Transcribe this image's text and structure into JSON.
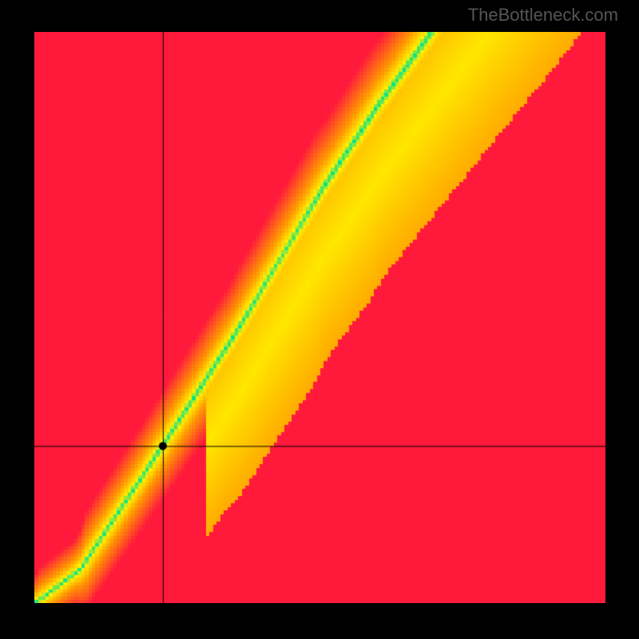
{
  "watermark": "TheBottleneck.com",
  "chart_data": {
    "type": "heatmap",
    "title": "",
    "xlabel": "",
    "ylabel": "",
    "xlim": [
      0,
      1
    ],
    "ylim": [
      0,
      1
    ],
    "crosshair": {
      "x": 0.225,
      "y": 0.275
    },
    "marker": {
      "x": 0.225,
      "y": 0.275
    },
    "ridge": {
      "description": "green optimal band running diagonally, curving steeper than 45deg; passes through approx (0.08,0.06),(0.22,0.27),(0.5,0.72),(0.68,0.98)",
      "points": [
        {
          "x": 0.0,
          "y": 0.0
        },
        {
          "x": 0.08,
          "y": 0.06
        },
        {
          "x": 0.22,
          "y": 0.27
        },
        {
          "x": 0.35,
          "y": 0.47
        },
        {
          "x": 0.5,
          "y": 0.72
        },
        {
          "x": 0.6,
          "y": 0.87
        },
        {
          "x": 0.68,
          "y": 0.98
        }
      ],
      "band_half_width": 0.05
    },
    "colors": {
      "optimal": "#00e28a",
      "near": "#fff100",
      "mid": "#ff9a00",
      "far": "#ff1a3c"
    }
  }
}
